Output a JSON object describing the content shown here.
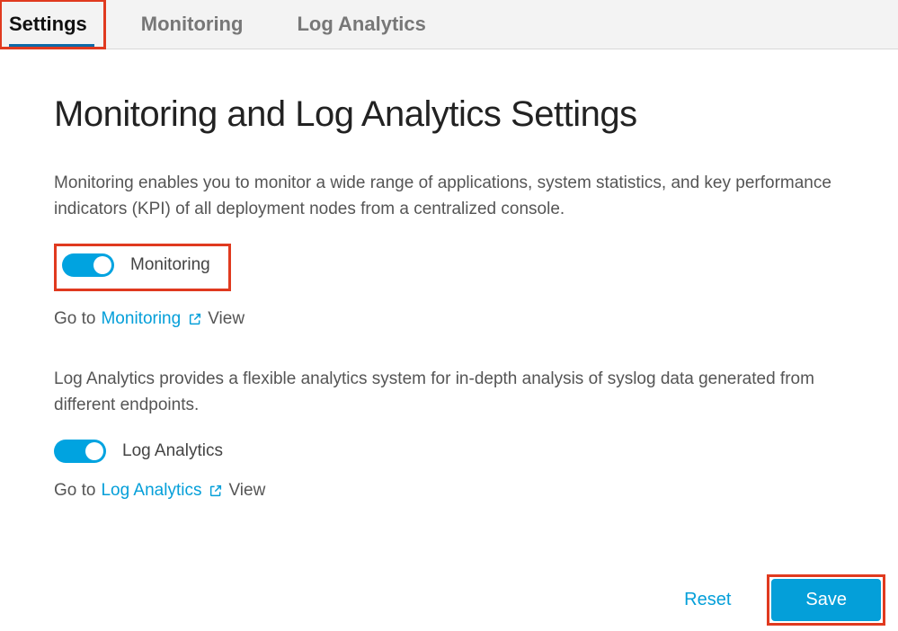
{
  "tabs": {
    "settings": "Settings",
    "monitoring": "Monitoring",
    "log_analytics": "Log Analytics"
  },
  "page": {
    "heading": "Monitoring and Log Analytics Settings"
  },
  "monitoring": {
    "description": "Monitoring enables you to monitor a wide range of applications, system statistics, and key performance indicators (KPI) of all deployment nodes from a centralized console.",
    "toggle_label": "Monitoring",
    "toggle_on": true,
    "goto_prefix": "Go to",
    "goto_link": "Monitoring",
    "goto_suffix": "View"
  },
  "log_analytics": {
    "description": "Log Analytics provides a flexible analytics system for in-depth analysis of syslog data generated from different endpoints.",
    "toggle_label": "Log Analytics",
    "toggle_on": true,
    "goto_prefix": "Go to",
    "goto_link": "Log Analytics",
    "goto_suffix": "View"
  },
  "footer": {
    "reset": "Reset",
    "save": "Save"
  }
}
